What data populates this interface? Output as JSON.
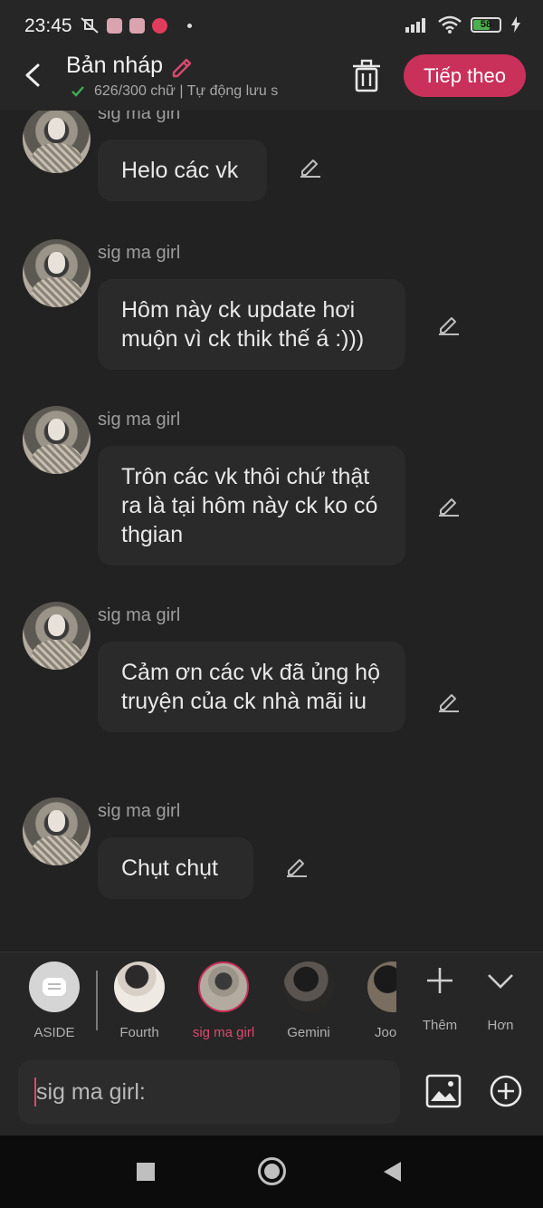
{
  "status_bar": {
    "time": "23:45",
    "battery_level": "58"
  },
  "header": {
    "title": "Bản nháp",
    "word_count": "626/300 chữ | Tự động lưu s",
    "next_label": "Tiếp theo"
  },
  "messages": [
    {
      "sender": "sig ma girl",
      "text": "Helo các vk"
    },
    {
      "sender": "sig ma girl",
      "text": "Hôm này ck update hơi muộn vì ck thik thế á :)))"
    },
    {
      "sender": "sig ma girl",
      "text": "Trôn các vk thôi chứ thật ra là tại hôm này ck ko có thgian"
    },
    {
      "sender": "sig ma girl",
      "text": "Cảm ơn các vk đã ủng hộ truyện của ck nhà mãi iu"
    },
    {
      "sender": "sig ma girl",
      "text": "Chụt chụt"
    }
  ],
  "characters": [
    {
      "label": "ASIDE",
      "active": false
    },
    {
      "label": "Fourth",
      "active": false
    },
    {
      "label": "sig ma girl",
      "active": true
    },
    {
      "label": "Gemini",
      "active": false
    },
    {
      "label": "Joo",
      "active": false
    }
  ],
  "char_actions": {
    "add_label": "Thêm",
    "more_label": "Hơn"
  },
  "composer": {
    "prefix": "sig ma girl:"
  },
  "colors": {
    "accent": "#c9305a",
    "background": "#222222",
    "bubble": "#2a2a2a"
  }
}
